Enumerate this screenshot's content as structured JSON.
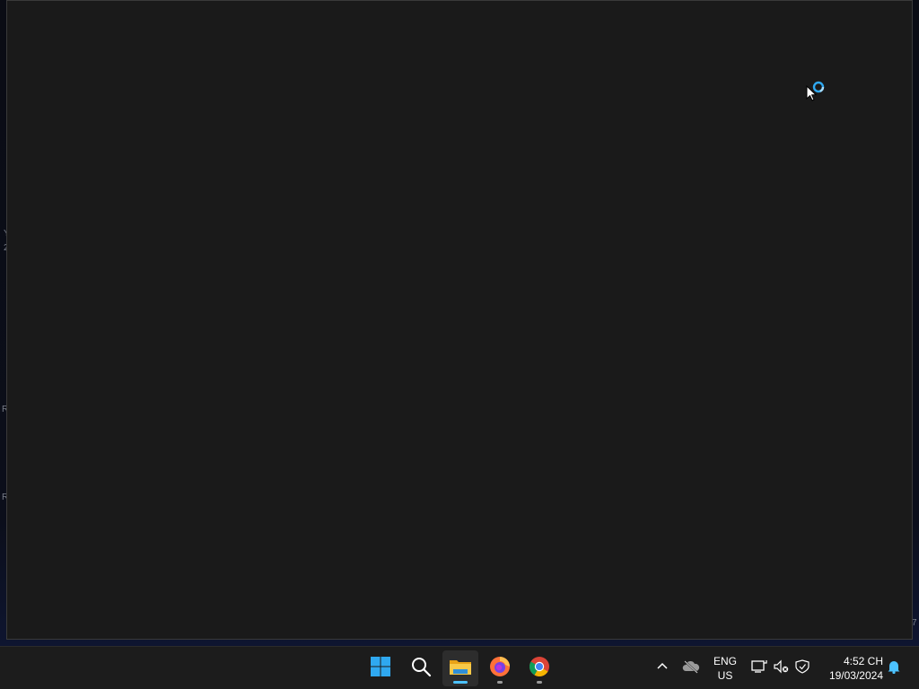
{
  "window": {
    "title": ""
  },
  "desktop": {
    "edge_glyphs": [
      "Y",
      "2",
      "R",
      "R",
      "7"
    ]
  },
  "taskbar": {
    "apps": [
      {
        "name": "Start",
        "icon": "windows-logo-icon"
      },
      {
        "name": "Search",
        "icon": "search-icon"
      },
      {
        "name": "File Explorer",
        "icon": "folder-icon",
        "active": true
      },
      {
        "name": "Firefox",
        "icon": "firefox-icon",
        "running": true
      },
      {
        "name": "Chrome",
        "icon": "chrome-icon",
        "running": true
      }
    ],
    "tray": {
      "icons": [
        "chevron-up-icon",
        "onedrive-offline-icon",
        "network-icon",
        "volume-muted-icon",
        "security-icon",
        "notification-bell-icon"
      ],
      "language_top": "ENG",
      "language_bottom": "US",
      "time": "4:52 CH",
      "date": "19/03/2024"
    }
  },
  "colors": {
    "window_bg": "#1a1a1a",
    "taskbar_bg": "#1c1c1c",
    "accent": "#4cc2ff",
    "start_blue": "#2fa8f0"
  }
}
